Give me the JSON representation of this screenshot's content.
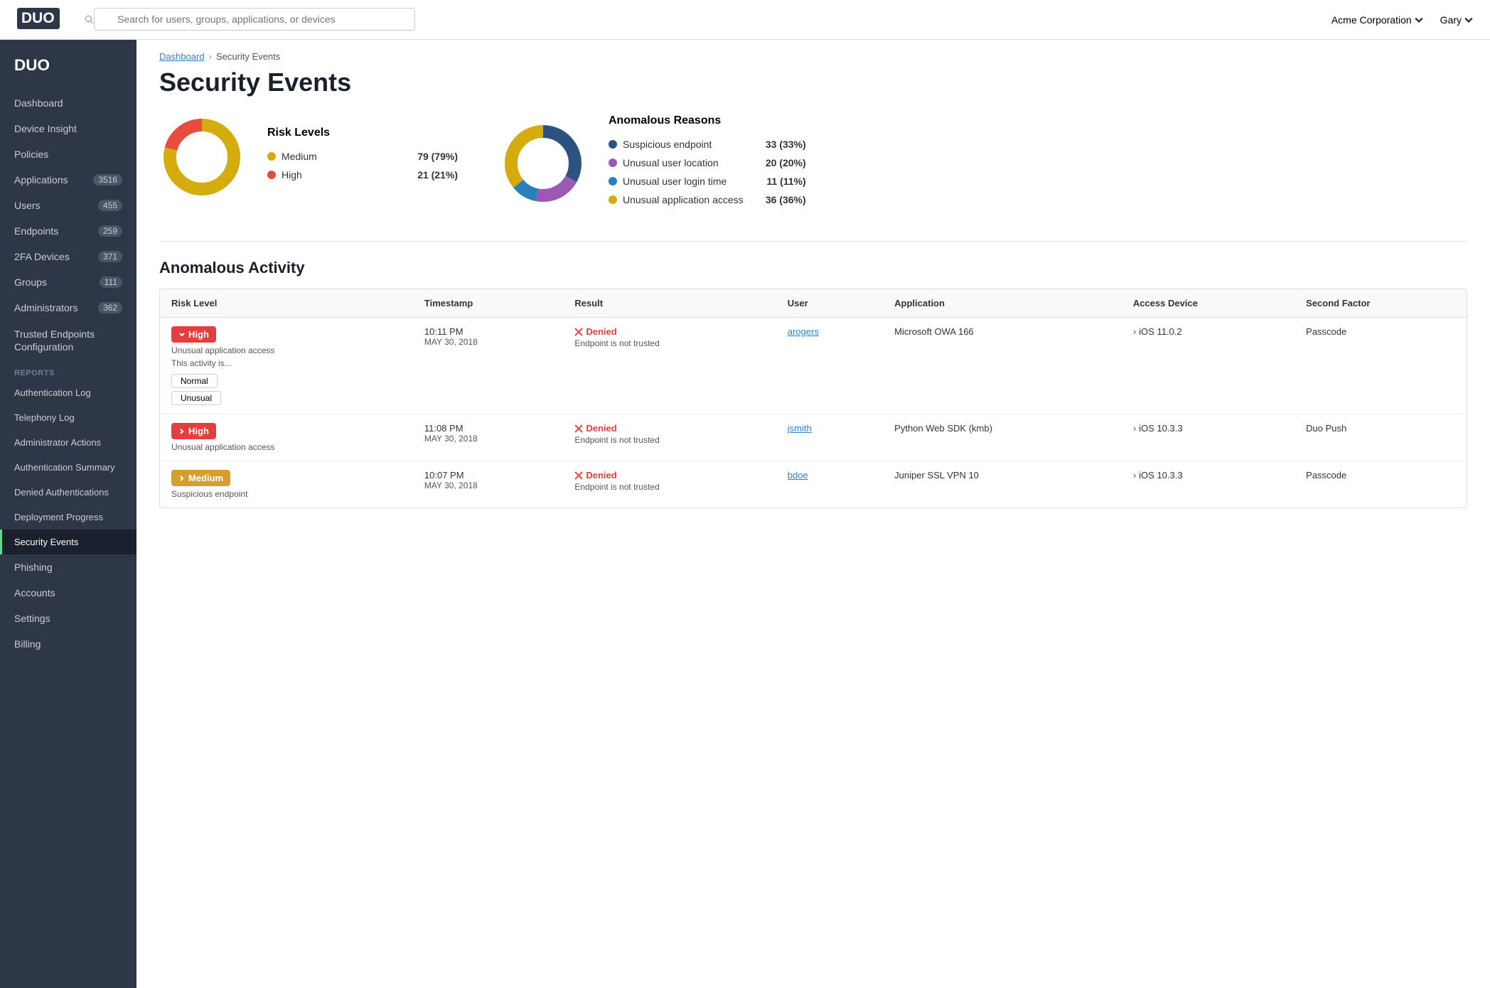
{
  "topbar": {
    "search_placeholder": "Search for users, groups, applications, or devices",
    "org_label": "Acme Corporation",
    "user_label": "Gary"
  },
  "sidebar": {
    "logo_alt": "Duo",
    "items": [
      {
        "id": "dashboard",
        "label": "Dashboard",
        "badge": null,
        "active": false,
        "sub": false
      },
      {
        "id": "device-insight",
        "label": "Device Insight",
        "badge": null,
        "active": false,
        "sub": false
      },
      {
        "id": "policies",
        "label": "Policies",
        "badge": null,
        "active": false,
        "sub": false
      },
      {
        "id": "applications",
        "label": "Applications",
        "badge": "3516",
        "active": false,
        "sub": false
      },
      {
        "id": "users",
        "label": "Users",
        "badge": "455",
        "active": false,
        "sub": false
      },
      {
        "id": "endpoints",
        "label": "Endpoints",
        "badge": "259",
        "active": false,
        "sub": false
      },
      {
        "id": "2fa-devices",
        "label": "2FA Devices",
        "badge": "371",
        "active": false,
        "sub": false
      },
      {
        "id": "groups",
        "label": "Groups",
        "badge": "111",
        "active": false,
        "sub": false
      },
      {
        "id": "administrators",
        "label": "Administrators",
        "badge": "362",
        "active": false,
        "sub": false
      },
      {
        "id": "trusted-endpoints",
        "label": "Trusted Endpoints Configuration",
        "badge": null,
        "active": false,
        "sub": false
      }
    ],
    "reports_section": "Reports",
    "report_items": [
      {
        "id": "authentication-log",
        "label": "Authentication Log",
        "active": false
      },
      {
        "id": "telephony-log",
        "label": "Telephony Log",
        "active": false
      },
      {
        "id": "administrator-actions",
        "label": "Administrator Actions",
        "active": false
      },
      {
        "id": "authentication-summary",
        "label": "Authentication Summary",
        "active": false
      },
      {
        "id": "denied-authentications",
        "label": "Denied Authentications",
        "active": false
      },
      {
        "id": "deployment-progress",
        "label": "Deployment Progress",
        "active": false
      },
      {
        "id": "security-events",
        "label": "Security Events",
        "active": true
      }
    ],
    "bottom_items": [
      {
        "id": "phishing",
        "label": "Phishing",
        "active": false
      },
      {
        "id": "accounts",
        "label": "Accounts",
        "active": false
      },
      {
        "id": "settings",
        "label": "Settings",
        "active": false
      },
      {
        "id": "billing",
        "label": "Billing",
        "active": false
      }
    ]
  },
  "breadcrumb": {
    "home": "Dashboard",
    "current": "Security Events"
  },
  "page": {
    "title": "Security Events"
  },
  "risk_chart": {
    "title": "Risk Levels",
    "legend": [
      {
        "color": "#d4ac0d",
        "label": "Medium",
        "value": "79 (79%)"
      },
      {
        "color": "#e74c3c",
        "label": "High",
        "value": "21 (21%)"
      }
    ],
    "donut": {
      "medium_pct": 79,
      "high_pct": 21,
      "medium_color": "#d4ac0d",
      "high_color": "#e74c3c"
    }
  },
  "anomalous_chart": {
    "title": "Anomalous Reasons",
    "legend": [
      {
        "color": "#2c5282",
        "label": "Suspicious endpoint",
        "value": "33 (33%)"
      },
      {
        "color": "#9b59b6",
        "label": "Unusual user location",
        "value": "20 (20%)"
      },
      {
        "color": "#2980b9",
        "label": "Unusual user login time",
        "value": "11 (11%)"
      },
      {
        "color": "#d4ac0d",
        "label": "Unusual application access",
        "value": "36 (36%)"
      }
    ],
    "donut": {
      "suspicious_pct": 33,
      "unusual_loc_pct": 20,
      "unusual_time_pct": 11,
      "unusual_app_pct": 36,
      "colors": [
        "#2c5282",
        "#9b59b6",
        "#2980b9",
        "#d4ac0d"
      ]
    }
  },
  "anomalous_activity": {
    "section_title": "Anomalous Activity",
    "columns": [
      "Risk Level",
      "Timestamp",
      "Result",
      "User",
      "Application",
      "Access Device",
      "Second Factor"
    ],
    "rows": [
      {
        "risk_level": "High",
        "risk_type": "high",
        "risk_icon": "chevron-down",
        "reason": "Unusual application access",
        "activity_label": "This activity is...",
        "buttons": [
          "Normal",
          "Unusual"
        ],
        "timestamp_time": "10:11 PM",
        "timestamp_date": "MAY 30, 2018",
        "result": "Denied",
        "result_reason": "Endpoint is not trusted",
        "user": "arogers",
        "application": "Microsoft OWA 166",
        "access_device": "iOS 11.0.2",
        "second_factor": "Passcode"
      },
      {
        "risk_level": "High",
        "risk_type": "high",
        "risk_icon": "chevron-right",
        "reason": "Unusual application access",
        "activity_label": null,
        "buttons": [],
        "timestamp_time": "11:08 PM",
        "timestamp_date": "MAY 30, 2018",
        "result": "Denied",
        "result_reason": "Endpoint is not trusted",
        "user": "jsmith",
        "application": "Python Web SDK (kmb)",
        "access_device": "iOS 10.3.3",
        "second_factor": "Duo Push"
      },
      {
        "risk_level": "Medium",
        "risk_type": "medium",
        "risk_icon": "chevron-right",
        "reason": "Suspicious endpoint",
        "activity_label": null,
        "buttons": [],
        "timestamp_time": "10:07 PM",
        "timestamp_date": "MAY 30, 2018",
        "result": "Denied",
        "result_reason": "Endpoint is not trusted",
        "user": "bdoe",
        "application": "Juniper SSL VPN 10",
        "access_device": "iOS 10.3.3",
        "second_factor": "Passcode"
      }
    ]
  }
}
